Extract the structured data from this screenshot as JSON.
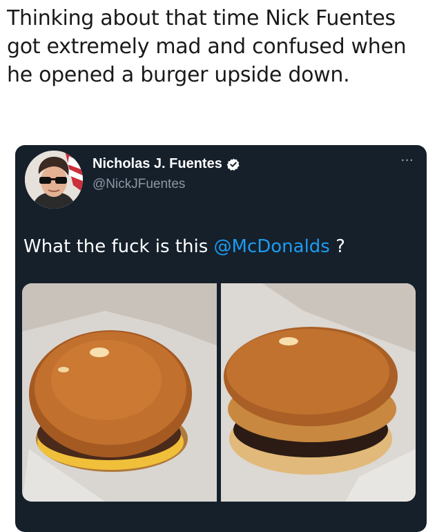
{
  "caption": "Thinking about that time Nick Fuentes got extremely mad and confused when he opened a burger upside down.",
  "tweet": {
    "display_name": "Nicholas J. Fuentes",
    "handle": "@NickJFuentes",
    "more_label": "···",
    "text_before": "What the fuck is this ",
    "mention": "@McDonalds",
    "text_after": " ?"
  },
  "colors": {
    "tweet_bg": "#15202b",
    "mention": "#1d9bf0",
    "handle": "#8b98a5",
    "verified_badge": "#ffffff"
  },
  "icons": [
    "verified-badge-icon",
    "more-options-icon"
  ]
}
